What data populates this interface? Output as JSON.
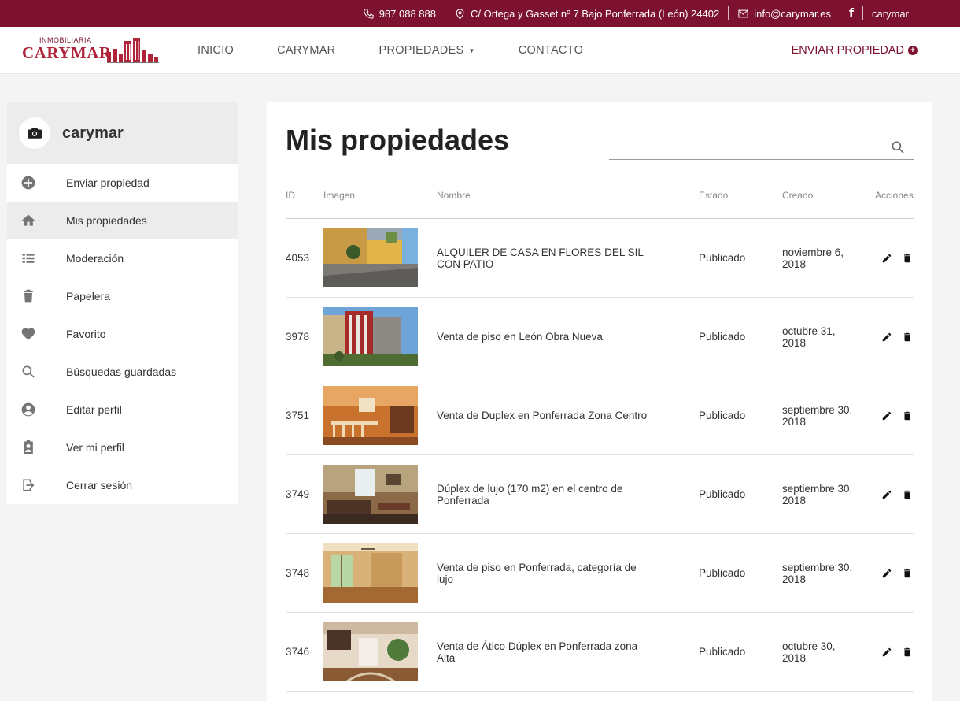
{
  "topbar": {
    "phone": "987 088 888",
    "address": "C/ Ortega y Gasset nº 7 Bajo Ponferrada (León) 24402",
    "email": "info@carymar.es",
    "facebook": "f",
    "user": "carymar"
  },
  "logo": {
    "small": "INMOBILIARIA",
    "big": "CARYMAR"
  },
  "nav": {
    "items": [
      "INICIO",
      "CARYMAR",
      "PROPIEDADES",
      "CONTACTO"
    ],
    "send_property": "ENVIAR PROPIEDAD"
  },
  "sidebar": {
    "username": "carymar",
    "items": [
      {
        "label": "Enviar propiedad",
        "icon": "add-circle-icon"
      },
      {
        "label": "Mis propiedades",
        "icon": "home-icon"
      },
      {
        "label": "Moderación",
        "icon": "list-icon"
      },
      {
        "label": "Papelera",
        "icon": "trash-icon"
      },
      {
        "label": "Favorito",
        "icon": "heart-icon"
      },
      {
        "label": "Búsquedas guardadas",
        "icon": "search-icon"
      },
      {
        "label": "Editar perfil",
        "icon": "account-circle-icon"
      },
      {
        "label": "Ver mi perfil",
        "icon": "profile-badge-icon"
      },
      {
        "label": "Cerrar sesión",
        "icon": "logout-icon"
      }
    ]
  },
  "main": {
    "title": "Mis propiedades",
    "search_placeholder": "",
    "columns": [
      "ID",
      "Imagen",
      "Nombre",
      "Estado",
      "Creado",
      "Acciones"
    ],
    "rows": [
      {
        "id": "4053",
        "name": "ALQUILER DE CASA EN FLORES DEL SIL CON PATIO",
        "status": "Publicado",
        "created": "noviembre 6, 2018"
      },
      {
        "id": "3978",
        "name": "Venta de piso en León Obra Nueva",
        "status": "Publicado",
        "created": "octubre 31, 2018"
      },
      {
        "id": "3751",
        "name": "Venta de Duplex en Ponferrada Zona Centro",
        "status": "Publicado",
        "created": "septiembre 30, 2018"
      },
      {
        "id": "3749",
        "name": "Dúplex de lujo (170 m2) en el centro de Ponferrada",
        "status": "Publicado",
        "created": "septiembre 30, 2018"
      },
      {
        "id": "3748",
        "name": "Venta de piso en Ponferrada, categoría de lujo",
        "status": "Publicado",
        "created": "septiembre 30, 2018"
      },
      {
        "id": "3746",
        "name": "Venta de Ático Dúplex en Ponferrada zona Alta",
        "status": "Publicado",
        "created": "octubre 30, 2018"
      }
    ]
  },
  "colors": {
    "brand": "#7c1230",
    "logo_red": "#b0243a"
  }
}
